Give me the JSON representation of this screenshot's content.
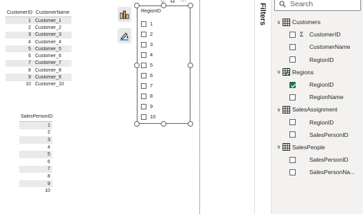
{
  "customers_table": {
    "headers": [
      "CustomerID",
      "CustomerName"
    ],
    "rows": [
      [
        "1",
        "Customer_1"
      ],
      [
        "2",
        "Customer_2"
      ],
      [
        "3",
        "Customer_3"
      ],
      [
        "4",
        "Customer_4"
      ],
      [
        "5",
        "Customer_5"
      ],
      [
        "6",
        "Customer_6"
      ],
      [
        "7",
        "Customer_7"
      ],
      [
        "8",
        "Customer_8"
      ],
      [
        "9",
        "Customer_9"
      ],
      [
        "10",
        "Customer_10"
      ]
    ]
  },
  "salesperson_table": {
    "header": "SalesPersonID",
    "rows": [
      "1",
      "2",
      "3",
      "4",
      "5",
      "6",
      "7",
      "8",
      "9",
      "10"
    ]
  },
  "slicer": {
    "title": "RegionID",
    "items": [
      "1",
      "2",
      "3",
      "4",
      "5",
      "6",
      "7",
      "8",
      "9",
      "10"
    ]
  },
  "filters_pane": {
    "label": "Filters"
  },
  "data_pane": {
    "search_placeholder": "Search",
    "accent_color": "#217346",
    "tables": [
      {
        "name": "Customers",
        "has_selection": false,
        "fields": [
          {
            "name": "CustomerID",
            "sigma": true,
            "checked": false
          },
          {
            "name": "CustomerName",
            "sigma": false,
            "checked": false
          },
          {
            "name": "RegionID",
            "sigma": false,
            "checked": false
          }
        ]
      },
      {
        "name": "Regions",
        "has_selection": true,
        "fields": [
          {
            "name": "RegionID",
            "sigma": false,
            "checked": true
          },
          {
            "name": "RegionName",
            "sigma": false,
            "checked": false
          }
        ]
      },
      {
        "name": "SalesAssignment",
        "has_selection": false,
        "fields": [
          {
            "name": "RegionID",
            "sigma": false,
            "checked": false
          },
          {
            "name": "SalesPersonID",
            "sigma": false,
            "checked": false
          }
        ]
      },
      {
        "name": "SalesPeople",
        "has_selection": false,
        "fields": [
          {
            "name": "SalesPersonID",
            "sigma": false,
            "checked": false
          },
          {
            "name": "SalesPersonNa...",
            "sigma": false,
            "checked": false
          }
        ]
      }
    ]
  }
}
